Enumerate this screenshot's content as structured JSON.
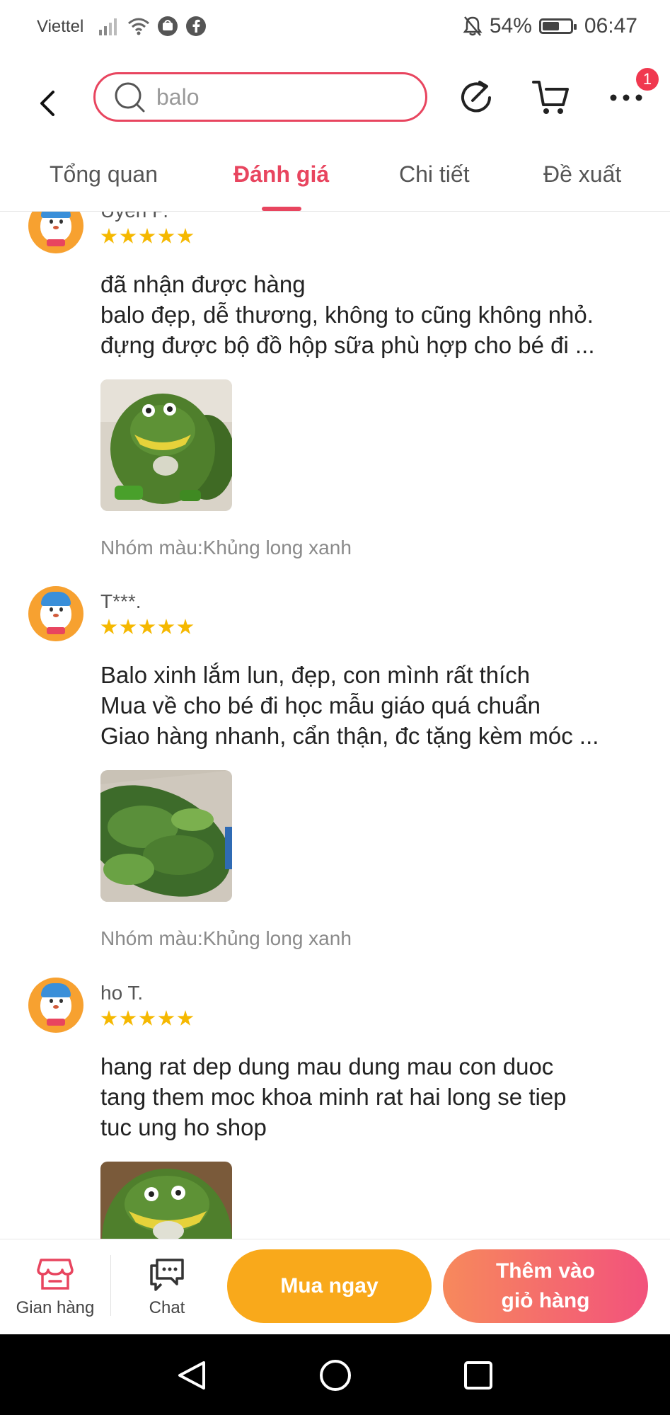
{
  "status_bar": {
    "carrier": "Viettel",
    "battery": "54%",
    "battery_level": 0.54,
    "time": "06:47"
  },
  "header": {
    "search_value": "balo",
    "cart_badge": "1",
    "icons": [
      "back-icon",
      "search-icon",
      "refresh-icon",
      "cart-icon",
      "more-icon"
    ]
  },
  "tabs": [
    {
      "label": "Tổng quan",
      "active": false
    },
    {
      "label": "Đánh giá",
      "active": true
    },
    {
      "label": "Chi tiết",
      "active": false
    },
    {
      "label": "Đề xuất",
      "active": false
    }
  ],
  "reviews": [
    {
      "name": "Uyen P.",
      "rating": 5,
      "lines": [
        "đã nhận được hàng",
        "balo đẹp, dễ thương, không to cũng không nhỏ.",
        "đựng được bộ đồ hộp sữa phù hợp cho bé đi ..."
      ],
      "photo": "green-dinosaur-backpack",
      "variant": "Nhóm màu:Khủng long xanh"
    },
    {
      "name": "T***.",
      "rating": 5,
      "lines": [
        "Balo xinh lắm lun, đẹp, con mình rất thích",
        "Mua về cho bé đi học mẫu giáo quá chuẩn",
        "Giao hàng nhanh, cẩn thận, đc tặng kèm móc ..."
      ],
      "photo": "green-leaves",
      "variant": "Nhóm màu:Khủng long xanh"
    },
    {
      "name": "ho T.",
      "rating": 5,
      "lines": [
        "hang rat dep dung mau dung mau con duoc",
        "tang them moc khoa minh rat hai long se tiep",
        "tuc ung ho shop"
      ],
      "photo": "green-dinosaur-backpack",
      "variant": ""
    }
  ],
  "bottom_bar": {
    "store_label": "Gian hàng",
    "chat_label": "Chat",
    "buy_now": "Mua ngay",
    "add_to_cart_line1": "Thêm vào",
    "add_to_cart_line2": "giỏ hàng"
  },
  "colors": {
    "accent": "#e8455f",
    "buy_now": "#f9a91b",
    "add_to_cart_start": "#f7895c",
    "add_to_cart_end": "#f2527c",
    "star": "#f5b800"
  }
}
